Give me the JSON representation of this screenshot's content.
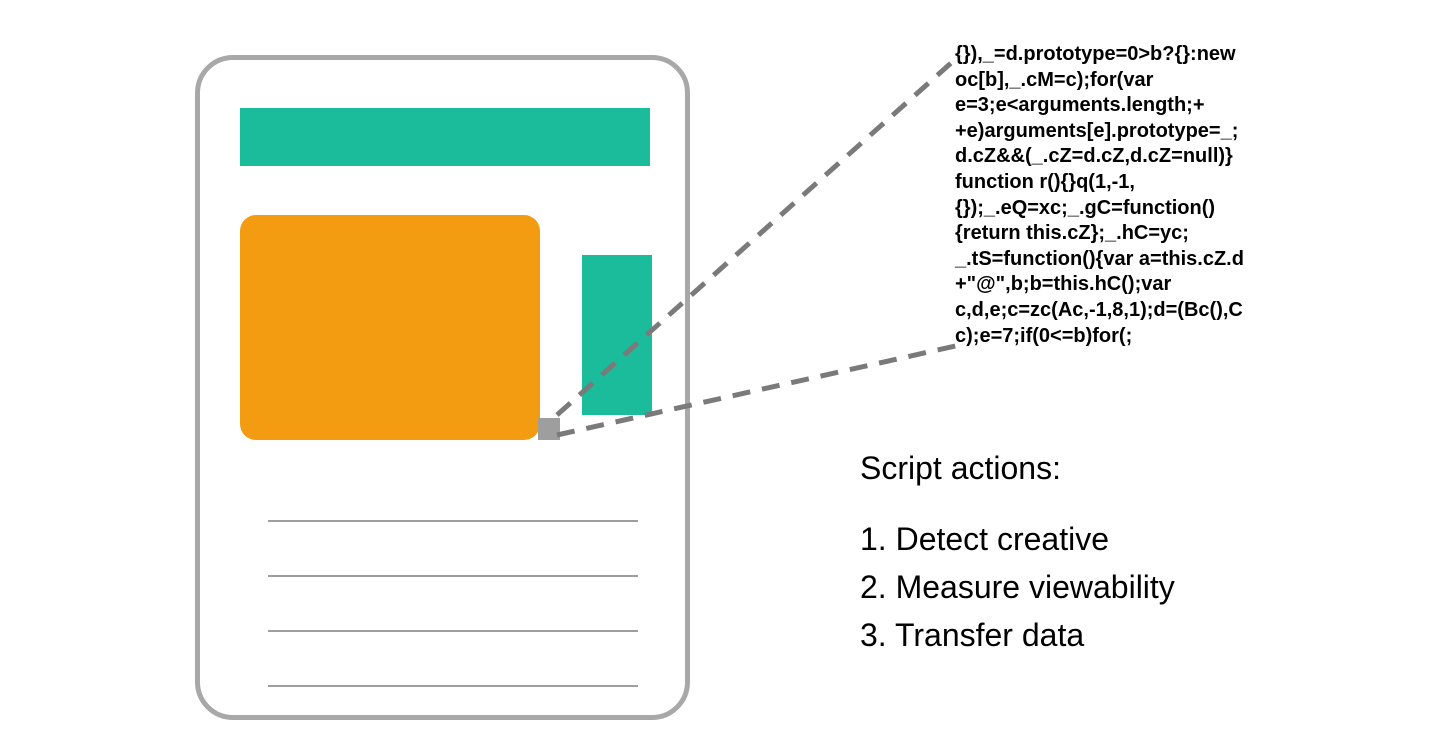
{
  "code_snippet": "{}),_=d.prototype=0>b?{}:new\noc[b],_.cM=c);for(var\ne=3;e<arguments.length;+\n+e)arguments[e].prototype=_;\nd.cZ&&(_.cZ=d.cZ,d.cZ=null)}\nfunction r(){}q(1,-1,\n{});_.eQ=xc;_.gC=function()\n{return this.cZ};_.hC=yc;\n_.tS=function(){var a=this.cZ.d\n+\"@\",b;b=this.hC();var\nc,d,e;c=zc(Ac,-1,8,1);d=(Bc(),C\nc);e=7;if(0<=b)for(;",
  "actions": {
    "heading": "Script actions:",
    "items": [
      "Detect creative",
      "Measure viewability",
      "Transfer data"
    ]
  },
  "colors": {
    "teal": "#1abc9c",
    "orange": "#f39c12",
    "gray_border": "#a8a8a8",
    "gray_pixel": "#9e9e9e"
  }
}
